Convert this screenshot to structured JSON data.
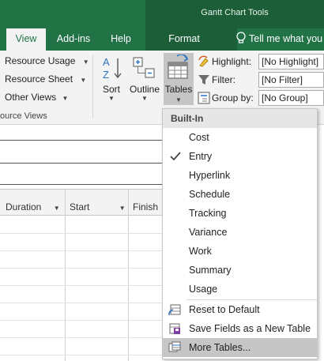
{
  "ribbon": {
    "context_title": "Gantt Chart Tools",
    "tabs": [
      {
        "label": "View",
        "active": true
      },
      {
        "label": "Add-ins",
        "active": false
      },
      {
        "label": "Help",
        "active": false
      },
      {
        "label": "Format",
        "active": false
      }
    ],
    "tell_me": "Tell me what you",
    "resource_views": {
      "items": [
        "Resource Usage",
        "Resource Sheet",
        "Other Views"
      ],
      "group_label": "ource Views"
    },
    "sort_label": "Sort",
    "outline_label": "Outline",
    "tables_label": "Tables",
    "data": {
      "highlight_label": "Highlight:",
      "highlight_value": "[No Highlight]",
      "filter_label": "Filter:",
      "filter_value": "[No Filter]",
      "groupby_label": "Group by:",
      "groupby_value": "[No Group]"
    }
  },
  "grid": {
    "columns": [
      "Duration",
      "Start",
      "Finish"
    ]
  },
  "tables_menu": {
    "header": "Built-In",
    "items": [
      "Cost",
      "Entry",
      "Hyperlink",
      "Schedule",
      "Tracking",
      "Variance",
      "Work",
      "Summary",
      "Usage"
    ],
    "checked": "Entry",
    "actions": [
      "Reset to Default",
      "Save Fields as a New Table",
      "More Tables..."
    ]
  },
  "colors": {
    "brand_green": "#217346",
    "context_green": "#1b5e38",
    "hover_gray": "#c6c6c6"
  }
}
